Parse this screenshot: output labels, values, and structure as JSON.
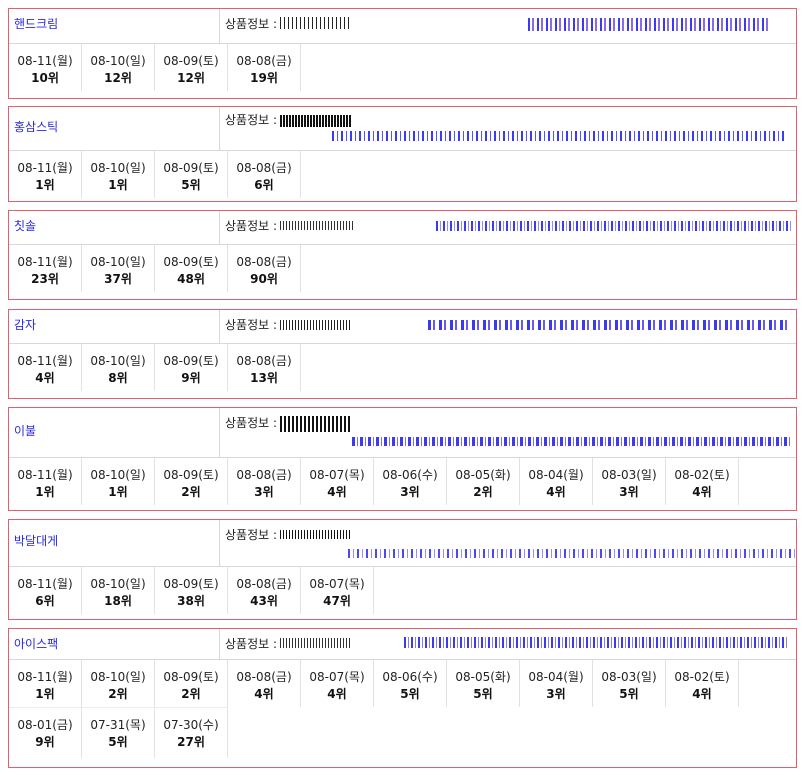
{
  "product_info_label": "상품정보 :",
  "keywords": [
    {
      "keyword": "핸드크림",
      "ranks": [
        {
          "date": "08-11(월)",
          "rank": "10위"
        },
        {
          "date": "08-10(일)",
          "rank": "12위"
        },
        {
          "date": "08-09(토)",
          "rank": "12위"
        },
        {
          "date": "08-08(금)",
          "rank": "19위"
        }
      ]
    },
    {
      "keyword": "홍삼스틱",
      "ranks": [
        {
          "date": "08-11(월)",
          "rank": "1위"
        },
        {
          "date": "08-10(일)",
          "rank": "1위"
        },
        {
          "date": "08-09(토)",
          "rank": "5위"
        },
        {
          "date": "08-08(금)",
          "rank": "6위"
        }
      ]
    },
    {
      "keyword": "칫솔",
      "ranks": [
        {
          "date": "08-11(월)",
          "rank": "23위"
        },
        {
          "date": "08-10(일)",
          "rank": "37위"
        },
        {
          "date": "08-09(토)",
          "rank": "48위"
        },
        {
          "date": "08-08(금)",
          "rank": "90위"
        }
      ]
    },
    {
      "keyword": "감자",
      "ranks": [
        {
          "date": "08-11(월)",
          "rank": "4위"
        },
        {
          "date": "08-10(일)",
          "rank": "8위"
        },
        {
          "date": "08-09(토)",
          "rank": "9위"
        },
        {
          "date": "08-08(금)",
          "rank": "13위"
        }
      ]
    },
    {
      "keyword": "이불",
      "ranks": [
        {
          "date": "08-11(월)",
          "rank": "1위"
        },
        {
          "date": "08-10(일)",
          "rank": "1위"
        },
        {
          "date": "08-09(토)",
          "rank": "2위"
        },
        {
          "date": "08-08(금)",
          "rank": "3위"
        },
        {
          "date": "08-07(목)",
          "rank": "4위"
        },
        {
          "date": "08-06(수)",
          "rank": "3위"
        },
        {
          "date": "08-05(화)",
          "rank": "2위"
        },
        {
          "date": "08-04(월)",
          "rank": "4위"
        },
        {
          "date": "08-03(일)",
          "rank": "3위"
        },
        {
          "date": "08-02(토)",
          "rank": "4위"
        }
      ]
    },
    {
      "keyword": "박달대게",
      "ranks": [
        {
          "date": "08-11(월)",
          "rank": "6위"
        },
        {
          "date": "08-10(일)",
          "rank": "18위"
        },
        {
          "date": "08-09(토)",
          "rank": "38위"
        },
        {
          "date": "08-08(금)",
          "rank": "43위"
        },
        {
          "date": "08-07(목)",
          "rank": "47위"
        }
      ]
    },
    {
      "keyword": "아이스팩",
      "ranks": [
        {
          "date": "08-11(월)",
          "rank": "1위"
        },
        {
          "date": "08-10(일)",
          "rank": "2위"
        },
        {
          "date": "08-09(토)",
          "rank": "2위"
        },
        {
          "date": "08-08(금)",
          "rank": "4위"
        },
        {
          "date": "08-07(목)",
          "rank": "4위"
        },
        {
          "date": "08-06(수)",
          "rank": "5위"
        },
        {
          "date": "08-05(화)",
          "rank": "5위"
        },
        {
          "date": "08-04(월)",
          "rank": "3위"
        },
        {
          "date": "08-03(일)",
          "rank": "5위"
        },
        {
          "date": "08-02(토)",
          "rank": "4위"
        },
        {
          "date": "08-01(금)",
          "rank": "9위"
        },
        {
          "date": "07-31(목)",
          "rank": "5위"
        },
        {
          "date": "07-30(수)",
          "rank": "27위"
        }
      ]
    }
  ]
}
